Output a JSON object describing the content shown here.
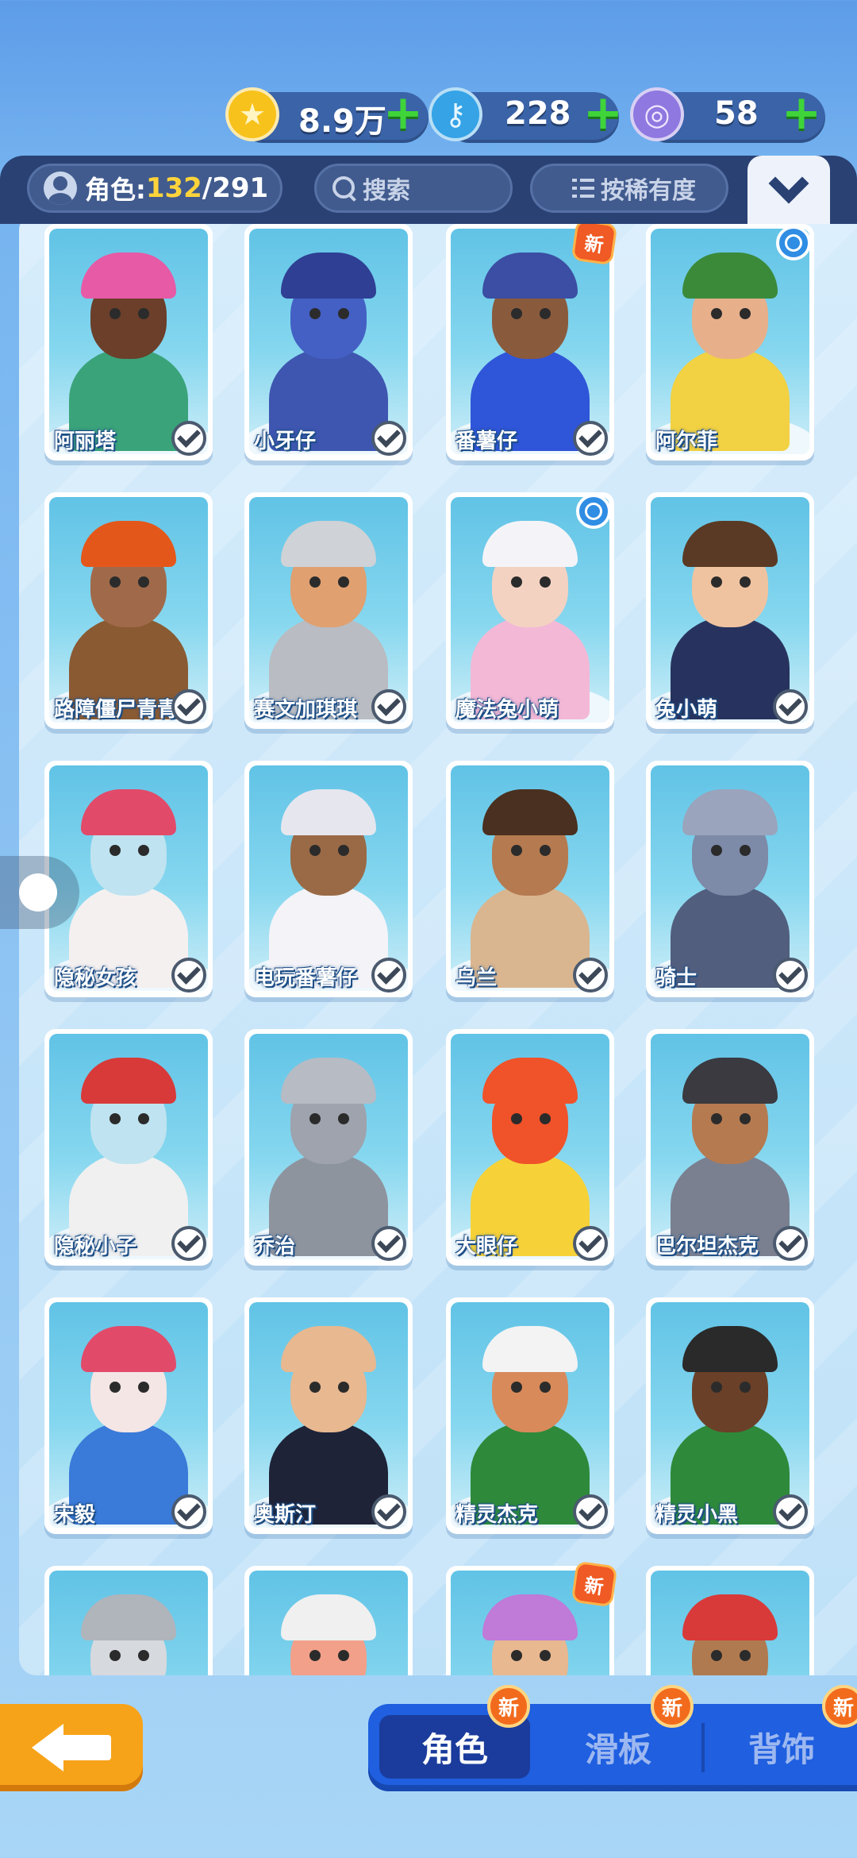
{
  "currency": {
    "coins": "8.9万",
    "keys": "228",
    "tokens": "58",
    "plus": "+"
  },
  "header": {
    "count_label": "角色:",
    "count_owned": "132",
    "count_sep": "/",
    "count_total": "291",
    "search_placeholder": "搜索",
    "sort_label": "按稀有度"
  },
  "characters": [
    {
      "name": "阿丽塔",
      "owned": true,
      "badge": "",
      "skin": "#6b3f2a",
      "outfit": "#3aa37a",
      "hat": "#e65aa6"
    },
    {
      "name": "小牙仔",
      "owned": true,
      "badge": "",
      "skin": "#4460c4",
      "outfit": "#3e56b0",
      "hat": "#2f3f94"
    },
    {
      "name": "番薯仔",
      "owned": true,
      "badge": "新",
      "skin": "#8a5a3c",
      "outfit": "#2f55d8",
      "hat": "#3b4ea3"
    },
    {
      "name": "阿尔菲",
      "owned": false,
      "badge": "timer",
      "skin": "#e7b08a",
      "outfit": "#f2d142",
      "hat": "#3b8a3a"
    },
    {
      "name": "路障僵尸青青",
      "owned": true,
      "badge": "",
      "skin": "#a06a4a",
      "outfit": "#8a5a32",
      "hat": "#e4571a"
    },
    {
      "name": "赛文加琪琪",
      "owned": true,
      "badge": "",
      "skin": "#e0a070",
      "outfit": "#b9bcc2",
      "hat": "#cfd2d6"
    },
    {
      "name": "魔法兔小萌",
      "owned": false,
      "badge": "timer",
      "skin": "#f3d2c2",
      "outfit": "#f3b8d6",
      "hat": "#f4f4f8"
    },
    {
      "name": "兔小萌",
      "owned": true,
      "badge": "",
      "skin": "#f0c3a0",
      "outfit": "#27335e",
      "hat": "#5a3a24"
    },
    {
      "name": "隐秘女孩",
      "owned": true,
      "badge": "",
      "skin": "#bfe3f0",
      "outfit": "#f5f0f0",
      "hat": "#e24a6a"
    },
    {
      "name": "电玩番薯仔",
      "owned": true,
      "badge": "",
      "skin": "#9a6a46",
      "outfit": "#f3f3f8",
      "hat": "#e6e6ee"
    },
    {
      "name": "乌兰",
      "owned": true,
      "badge": "",
      "skin": "#b57a50",
      "outfit": "#d9b690",
      "hat": "#4a3020"
    },
    {
      "name": "骑士",
      "owned": true,
      "badge": "",
      "skin": "#7d8aa8",
      "outfit": "#525e7e",
      "hat": "#9aa4bc"
    },
    {
      "name": "隐秘小子",
      "owned": true,
      "badge": "",
      "skin": "#bfe3f0",
      "outfit": "#f0f0f0",
      "hat": "#d83a3a"
    },
    {
      "name": "乔治",
      "owned": true,
      "badge": "",
      "skin": "#9ea3ad",
      "outfit": "#8e949e",
      "hat": "#b6bbc4"
    },
    {
      "name": "大眼仔",
      "owned": true,
      "badge": "",
      "skin": "#f0522a",
      "outfit": "#f6d238",
      "hat": "#f0522a"
    },
    {
      "name": "巴尔坦杰克",
      "owned": true,
      "badge": "",
      "skin": "#b57a50",
      "outfit": "#7a8090",
      "hat": "#3a3a40"
    },
    {
      "name": "宋毅",
      "owned": true,
      "badge": "",
      "skin": "#f5e6e6",
      "outfit": "#3a7ad8",
      "hat": "#e24a6a"
    },
    {
      "name": "奥斯汀",
      "owned": true,
      "badge": "",
      "skin": "#e8b890",
      "outfit": "#1e2338",
      "hat": "#e8b890"
    },
    {
      "name": "精灵杰克",
      "owned": true,
      "badge": "",
      "skin": "#d88a5a",
      "outfit": "#2e8a3a",
      "hat": "#f3f3f3"
    },
    {
      "name": "精灵小黑",
      "owned": true,
      "badge": "",
      "skin": "#6a4028",
      "outfit": "#2e8a3a",
      "hat": "#2a2a2a"
    },
    {
      "name": "",
      "owned": false,
      "badge": "",
      "skin": "#d6d9de",
      "outfit": "#c2c6cc",
      "hat": "#b0b4bb"
    },
    {
      "name": "",
      "owned": false,
      "badge": "",
      "skin": "#f2a08a",
      "outfit": "#e05a5a",
      "hat": "#f0f0f0"
    },
    {
      "name": "",
      "owned": false,
      "badge": "新",
      "skin": "#e8b890",
      "outfit": "#7a5ad8",
      "hat": "#c07ad8"
    },
    {
      "name": "",
      "owned": false,
      "badge": "",
      "skin": "#b07a50",
      "outfit": "#d83a3a",
      "hat": "#d83a3a"
    }
  ],
  "tabs": [
    {
      "label": "角色",
      "active": true,
      "new": "新"
    },
    {
      "label": "滑板",
      "active": false,
      "new": "新"
    },
    {
      "label": "背饰",
      "active": false,
      "new": "新"
    }
  ],
  "icons": {
    "coin": "coin-icon",
    "key": "key-icon",
    "token": "token-icon",
    "back": "back-arrow-icon"
  },
  "colors": {
    "coin": "#f7c21b",
    "key": "#35a3e6",
    "token": "#8f78e0",
    "tab_bar": "#1f5fe0",
    "back_button": "#f7a319"
  }
}
